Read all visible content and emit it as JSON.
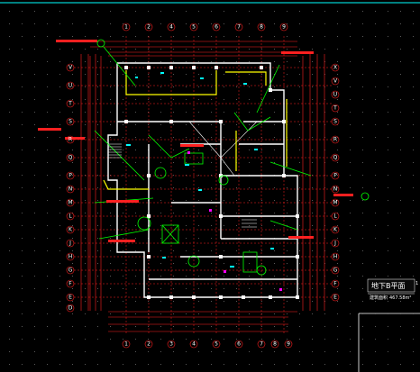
{
  "drawing": {
    "title": "地下B平面",
    "scale_mark": "1",
    "subtitle_left": "建筑面积",
    "subtitle_right": "467.58m²"
  },
  "axes": {
    "top": [
      "1",
      "2",
      "4",
      "5",
      "6",
      "7",
      "8",
      "9"
    ],
    "bottom": [
      "1",
      "2",
      "3",
      "4",
      "5",
      "6",
      "7",
      "8",
      "9"
    ],
    "left": [
      "V",
      "U",
      "T",
      "S",
      "R",
      "Q",
      "P",
      "N",
      "M",
      "L",
      "K",
      "J",
      "H",
      "G",
      "F",
      "E",
      "D"
    ],
    "right": [
      "X",
      "V",
      "U",
      "T",
      "S",
      "R",
      "Q",
      "P",
      "N",
      "M",
      "L",
      "K",
      "J",
      "H",
      "G",
      "F",
      "E"
    ]
  },
  "colors": {
    "background": "#000000",
    "frame": "#00ffff",
    "walls": "#ffffff",
    "dimensions": "#ff2020",
    "annotations": "#00ff00",
    "accent_yellow": "#ffff00",
    "labels": "#00ffff",
    "magenta": "#ff00ff"
  }
}
